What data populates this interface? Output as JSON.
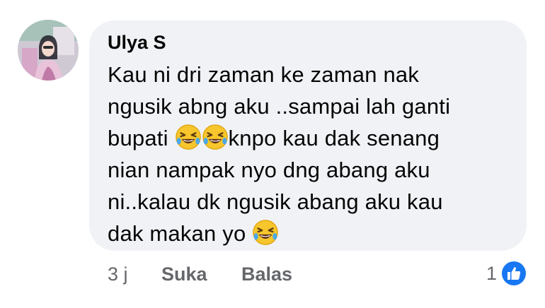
{
  "comment": {
    "author": "Ulya S",
    "lines": [
      "Kau ni dri zaman ke zaman nak",
      "ngusik abng aku ..sampai lah ganti",
      "bupati",
      "knpo kau dak senang",
      "nian nampak nyo dng abang aku",
      "ni..kalau dk ngusik abang aku kau",
      "dak makan yo"
    ],
    "emoji": "rolling-on-floor-laughing"
  },
  "actions": {
    "time": "3 j",
    "like_label": "Suka",
    "reply_label": "Balas"
  },
  "reactions": {
    "count": "1",
    "icon": "thumbs-up-icon",
    "color": "#1877f2"
  },
  "colors": {
    "bubble": "#f0f2f5",
    "meta_text": "#65676b",
    "text": "#050505"
  }
}
